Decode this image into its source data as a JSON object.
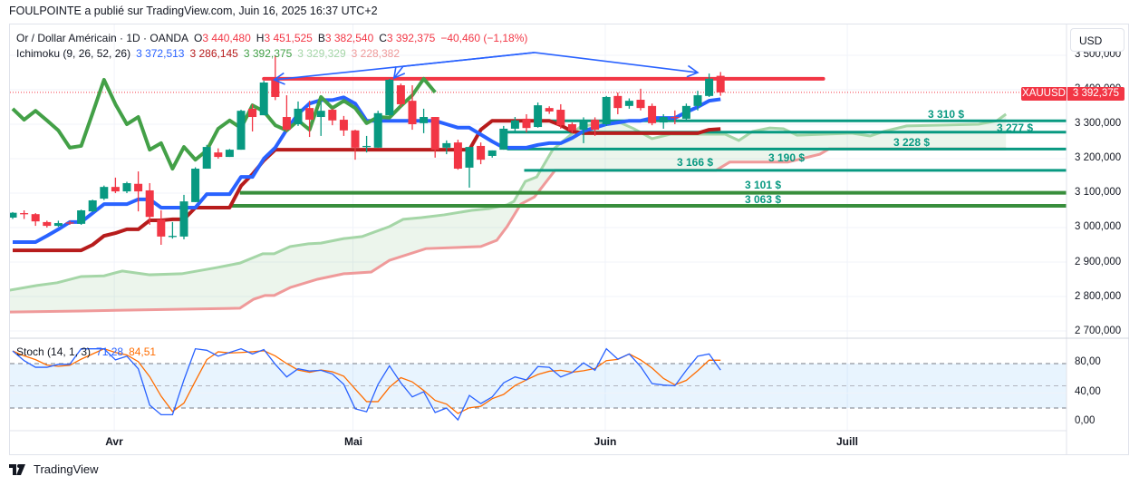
{
  "header": {
    "published": "FOULPOINTE a publié sur TradingView.com, Juin 16, 2025 16:37 UTC+2"
  },
  "legend": {
    "symbol": "Or / Dollar Américain · 1D · OANDA",
    "o_label": "O",
    "o": "3 440,480",
    "h_label": "H",
    "h": "3 451,525",
    "b_label": "B",
    "b": "3 382,540",
    "c_label": "C",
    "c": "3 392,375",
    "change": "−40,460 (−1,18%)",
    "ichimoku": "Ichimoku (9, 26, 52, 26)",
    "tenkan": "3 372,513",
    "kijun": "3 286,145",
    "chikou": "3 392,375",
    "senkou_a": "3 329,329",
    "senkou_b": "3 228,382",
    "stoch": "Stoch (14, 1, 3)",
    "stoch_k": "71,28",
    "stoch_d": "84,51"
  },
  "currency_button": "USD",
  "symbol_tag": "XAUUSD",
  "last_price": "3 392,375",
  "price_axis": [
    "3 500,000",
    "3 400,000",
    "3 300,000",
    "3 200,000",
    "3 100,000",
    "3 000,000",
    "2 900,000",
    "2 800,000",
    "2 700,000"
  ],
  "stoch_axis": [
    "80,00",
    "40,00",
    "0,00"
  ],
  "time_axis": [
    "Avr",
    "Mai",
    "Juin",
    "Juill"
  ],
  "logo_text": "TradingView",
  "colors": {
    "up": "#089981",
    "down": "#f23645",
    "tenkan": "#2962ff",
    "kijun": "#b71c1c",
    "chikou": "#43a047",
    "senkou_a": "#a5d6a7",
    "senkou_b": "#ef9a9a",
    "level_teal": "#089981",
    "level_green": "#388e3c",
    "resistance": "#f23645",
    "stoch_k": "#2962ff",
    "stoch_d": "#ff6d00"
  },
  "chart_data": {
    "type": "candlestick",
    "symbol": "XAUUSD",
    "timeframe": "1D",
    "ylim": [
      2680,
      3530
    ],
    "price_ticks": [
      3500,
      3400,
      3300,
      3200,
      3100,
      3000,
      2900,
      2800,
      2700
    ],
    "time_ticks": [
      {
        "label": "Avr",
        "bar": 8.9
      },
      {
        "label": "Mai",
        "bar": 29.8
      },
      {
        "label": "Juin",
        "bar": 51.9
      },
      {
        "label": "Juill",
        "bar": 73.1
      }
    ],
    "ohlc": [
      [
        3029,
        3045,
        3025,
        3043
      ],
      [
        3042,
        3050,
        3025,
        3040
      ],
      [
        3039,
        3042,
        3005,
        3018
      ],
      [
        3016,
        3020,
        3000,
        3005
      ],
      [
        3005,
        3020,
        3002,
        3013
      ],
      [
        3015,
        3020,
        3008,
        3013
      ],
      [
        3011,
        3052,
        3008,
        3050
      ],
      [
        3047,
        3081,
        3045,
        3079
      ],
      [
        3084,
        3122,
        3080,
        3118
      ],
      [
        3118,
        3145,
        3100,
        3105
      ],
      [
        3105,
        3133,
        3100,
        3129
      ],
      [
        3127,
        3163,
        3047,
        3105
      ],
      [
        3108,
        3129,
        3008,
        3031
      ],
      [
        3023,
        3050,
        2950,
        2974
      ],
      [
        2974,
        3016,
        2968,
        2976
      ],
      [
        2974,
        3095,
        2966,
        3076
      ],
      [
        3074,
        3175,
        3074,
        3171
      ],
      [
        3171,
        3240,
        3171,
        3234
      ],
      [
        3218,
        3230,
        3200,
        3205
      ],
      [
        3205,
        3228,
        3205,
        3226
      ],
      [
        3226,
        3342,
        3226,
        3339
      ],
      [
        3345,
        3358,
        3279,
        3321
      ],
      [
        3326,
        3426,
        3326,
        3421
      ],
      [
        3429,
        3500,
        3370,
        3379
      ],
      [
        3321,
        3384,
        3279,
        3284
      ],
      [
        3300,
        3366,
        3295,
        3345
      ],
      [
        3347,
        3368,
        3263,
        3313
      ],
      [
        3321,
        3366,
        3266,
        3339
      ],
      [
        3342,
        3345,
        3297,
        3311
      ],
      [
        3313,
        3324,
        3266,
        3282
      ],
      [
        3282,
        3284,
        3197,
        3232
      ],
      [
        3235,
        3266,
        3218,
        3237
      ],
      [
        3232,
        3339,
        3232,
        3332
      ],
      [
        3326,
        3432,
        3326,
        3429
      ],
      [
        3413,
        3418,
        3350,
        3358
      ],
      [
        3368,
        3413,
        3284,
        3300
      ],
      [
        3303,
        3345,
        3274,
        3321
      ],
      [
        3321,
        3321,
        3203,
        3226
      ],
      [
        3232,
        3253,
        3213,
        3245
      ],
      [
        3247,
        3255,
        3168,
        3171
      ],
      [
        3174,
        3234,
        3116,
        3234
      ],
      [
        3237,
        3247,
        3184,
        3197
      ],
      [
        3208,
        3224,
        3203,
        3224
      ],
      [
        3226,
        3295,
        3226,
        3287
      ],
      [
        3287,
        3321,
        3280,
        3311
      ],
      [
        3316,
        3329,
        3276,
        3289
      ],
      [
        3292,
        3363,
        3290,
        3355
      ],
      [
        3347,
        3352,
        3330,
        3337
      ],
      [
        3342,
        3358,
        3287,
        3297
      ],
      [
        3300,
        3305,
        3275,
        3282
      ],
      [
        3284,
        3320,
        3245,
        3311
      ],
      [
        3313,
        3320,
        3266,
        3284
      ],
      [
        3300,
        3382,
        3295,
        3379
      ],
      [
        3382,
        3392,
        3329,
        3347
      ],
      [
        3353,
        3375,
        3345,
        3368
      ],
      [
        3371,
        3403,
        3340,
        3347
      ],
      [
        3353,
        3360,
        3297,
        3303
      ],
      [
        3305,
        3329,
        3287,
        3321
      ],
      [
        3321,
        3340,
        3300,
        3319
      ],
      [
        3316,
        3360,
        3311,
        3353
      ],
      [
        3353,
        3397,
        3340,
        3384
      ],
      [
        3382,
        3447,
        3379,
        3432
      ],
      [
        3440.48,
        3451.525,
        3382.54,
        3392.375
      ]
    ],
    "ichimoku": {
      "displacement": 25,
      "tenkan": [
        2958,
        2958,
        2958,
        2976,
        2995,
        3016,
        3016,
        3042,
        3068,
        3068,
        3068,
        3082,
        3082,
        3058,
        3058,
        3058,
        3058,
        3097,
        3097,
        3097,
        3147,
        3147,
        3200,
        3232,
        3284,
        3330,
        3360,
        3370,
        3370,
        3378,
        3360,
        3310,
        3310,
        3310,
        3310,
        3310,
        3310,
        3310,
        3300,
        3290,
        3290,
        3270,
        3250,
        3232,
        3232,
        3232,
        3240,
        3245,
        3245,
        3260,
        3280,
        3290,
        3300,
        3305,
        3310,
        3310,
        3318,
        3318,
        3318,
        3335,
        3350,
        3368,
        3372.513
      ],
      "kijun": [
        2934,
        2934,
        2934,
        2934,
        2934,
        2934,
        2934,
        2950,
        2976,
        2984,
        2995,
        2995,
        3021,
        3021,
        3024,
        3024,
        3058,
        3058,
        3058,
        3058,
        3121,
        3155,
        3195,
        3226,
        3226,
        3226,
        3226,
        3226,
        3226,
        3226,
        3226,
        3226,
        3226,
        3226,
        3226,
        3226,
        3226,
        3226,
        3226,
        3226,
        3226,
        3284,
        3310,
        3310,
        3310,
        3310,
        3310,
        3310,
        3297,
        3279,
        3274,
        3274,
        3274,
        3274,
        3274,
        3274,
        3274,
        3274,
        3274,
        3274,
        3274,
        3284,
        3286.145
      ],
      "senkou_a": [
        [
          -0.3,
          2818
        ],
        [
          2.1,
          2832
        ],
        [
          3.9,
          2840
        ],
        [
          6,
          2858
        ],
        [
          8,
          2860
        ],
        [
          9.6,
          2874
        ],
        [
          12,
          2863
        ],
        [
          14.8,
          2866
        ],
        [
          17.9,
          2884
        ],
        [
          19.9,
          2897
        ],
        [
          21.9,
          2924
        ],
        [
          22.9,
          2924
        ],
        [
          24.3,
          2945
        ],
        [
          25.9,
          2953
        ],
        [
          27,
          2955
        ],
        [
          29,
          2968
        ],
        [
          30.6,
          2974
        ],
        [
          33,
          3003
        ],
        [
          34.2,
          3024
        ],
        [
          35.8,
          3029
        ],
        [
          37.8,
          3037
        ],
        [
          40.2,
          3050
        ],
        [
          41.7,
          3055
        ],
        [
          43.3,
          3066
        ],
        [
          43.9,
          3076
        ],
        [
          44.9,
          3134
        ],
        [
          45.9,
          3147
        ],
        [
          47.3,
          3226
        ],
        [
          49.7,
          3292
        ],
        [
          50.9,
          3300
        ],
        [
          53.2,
          3305
        ],
        [
          54.4,
          3287
        ],
        [
          56,
          3258
        ],
        [
          57.6,
          3271
        ],
        [
          62.4,
          3271
        ],
        [
          63.6,
          3253
        ],
        [
          64.8,
          3279
        ],
        [
          66.3,
          3289
        ],
        [
          67.5,
          3287
        ],
        [
          68.7,
          3268
        ],
        [
          73.5,
          3274
        ],
        [
          75.1,
          3266
        ],
        [
          76.3,
          3279
        ],
        [
          78.3,
          3295
        ],
        [
          84.6,
          3300
        ],
        [
          86.2,
          3310
        ],
        [
          87,
          3329.329
        ]
      ],
      "senkou_b": [
        [
          -0.3,
          2755
        ],
        [
          6,
          2758
        ],
        [
          19.9,
          2766
        ],
        [
          21.1,
          2792
        ],
        [
          22.1,
          2803
        ],
        [
          22.9,
          2803
        ],
        [
          24.3,
          2826
        ],
        [
          26.7,
          2850
        ],
        [
          29,
          2866
        ],
        [
          31.4,
          2871
        ],
        [
          33,
          2905
        ],
        [
          36.2,
          2939
        ],
        [
          41,
          2945
        ],
        [
          42.4,
          2963
        ],
        [
          43.3,
          3003
        ],
        [
          44.5,
          3068
        ],
        [
          45.7,
          3089
        ],
        [
          47.5,
          3166
        ],
        [
          61.6,
          3166
        ],
        [
          62.8,
          3190
        ],
        [
          67.9,
          3190
        ],
        [
          70.7,
          3213
        ],
        [
          71.5,
          3228.382
        ],
        [
          87,
          3228.382
        ]
      ]
    },
    "levels": [
      {
        "price": 3310,
        "label": "3 310 $",
        "kind": "teal",
        "from_bar": 43.3
      },
      {
        "price": 3277,
        "label": "3 277 $",
        "kind": "teal",
        "from_bar": 43.3
      },
      {
        "price": 3228,
        "label": "3 228 $",
        "kind": "teal",
        "from_bar": 43.3
      },
      {
        "price": 3190,
        "label": "3 190 $",
        "kind": "label-only",
        "from_bar": 62.8
      },
      {
        "price": 3166,
        "label": "3 166 $",
        "kind": "teal",
        "from_bar": 44.8
      },
      {
        "price": 3101,
        "label": "3 101 $",
        "kind": "green",
        "from_bar": 19.9
      },
      {
        "price": 3063,
        "label": "3 063 $",
        "kind": "green",
        "from_bar": 19.1
      }
    ],
    "resistance": {
      "price": 3432,
      "from_bar": 22,
      "to_bar": 71
    },
    "last_price": 3392.375,
    "drawings": [
      {
        "name": "arrow-back-to-high",
        "points": [
          [
            45.7,
            3508
          ],
          [
            22.9,
            3429
          ]
        ]
      },
      {
        "name": "arrow-back-to-second-high",
        "points": [
          [
            45.7,
            3508
          ],
          [
            34.2,
            3468
          ],
          [
            33.4,
            3434
          ]
        ]
      },
      {
        "name": "arrow-forward",
        "points": [
          [
            45.7,
            3508
          ],
          [
            60,
            3450
          ]
        ]
      }
    ],
    "stochastic": {
      "params": [
        14,
        1,
        3
      ],
      "bands": [
        80,
        50,
        20
      ],
      "ylim": [
        0,
        100
      ],
      "k": [
        97,
        84,
        75,
        75,
        79,
        79,
        100,
        100,
        100,
        85,
        90,
        73,
        24,
        11,
        11,
        58,
        100,
        98,
        90,
        95,
        100,
        93,
        99,
        79,
        62,
        73,
        70,
        71,
        66,
        52,
        19,
        15,
        52,
        77,
        54,
        35,
        42,
        14,
        20,
        4,
        37,
        26,
        35,
        54,
        62,
        58,
        76,
        75,
        62,
        68,
        81,
        71,
        100,
        86,
        93,
        76,
        53,
        51,
        50,
        71,
        90,
        93,
        71.28
      ],
      "d_last": 84.51
    }
  }
}
